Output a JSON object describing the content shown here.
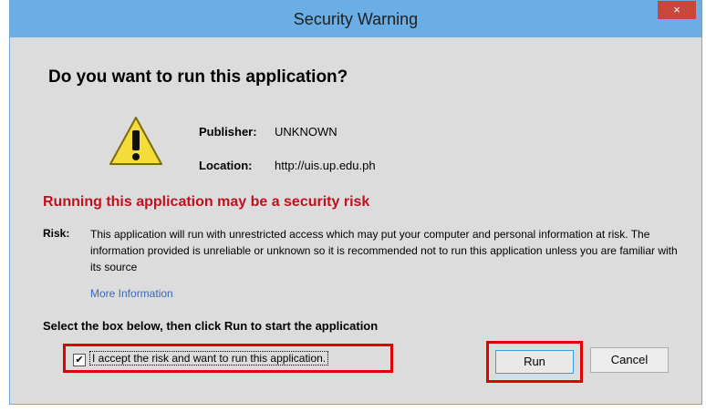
{
  "window": {
    "title": "Security Warning",
    "close_label": "×"
  },
  "dialog": {
    "heading": "Do you want to run this application?",
    "publisher_label": "Publisher:",
    "publisher_value": "UNKNOWN",
    "location_label": "Location:",
    "location_value": "http://uis.up.edu.ph",
    "risk_heading": "Running this application may be a security risk",
    "risk_label": "Risk:",
    "risk_text": "This application will run with unrestricted access which may put your computer and personal information at risk. The information provided is unreliable or unknown so it is recommended not to run this application unless you are familiar with its source",
    "more_info": "More Information",
    "instruction": "Select the box below, then click Run to start the application",
    "accept_checkbox_mark": "✔",
    "accept_checked": true,
    "accept_label": "I accept the risk and want to run this application."
  },
  "buttons": {
    "run": "Run",
    "cancel": "Cancel"
  },
  "colors": {
    "titlebar": "#6aaee5",
    "close": "#c7473c",
    "risk_heading": "#c0111f",
    "link": "#3c68b0",
    "highlight": "#e00000"
  },
  "icons": {
    "warning": "warning-icon",
    "close": "close-icon"
  }
}
